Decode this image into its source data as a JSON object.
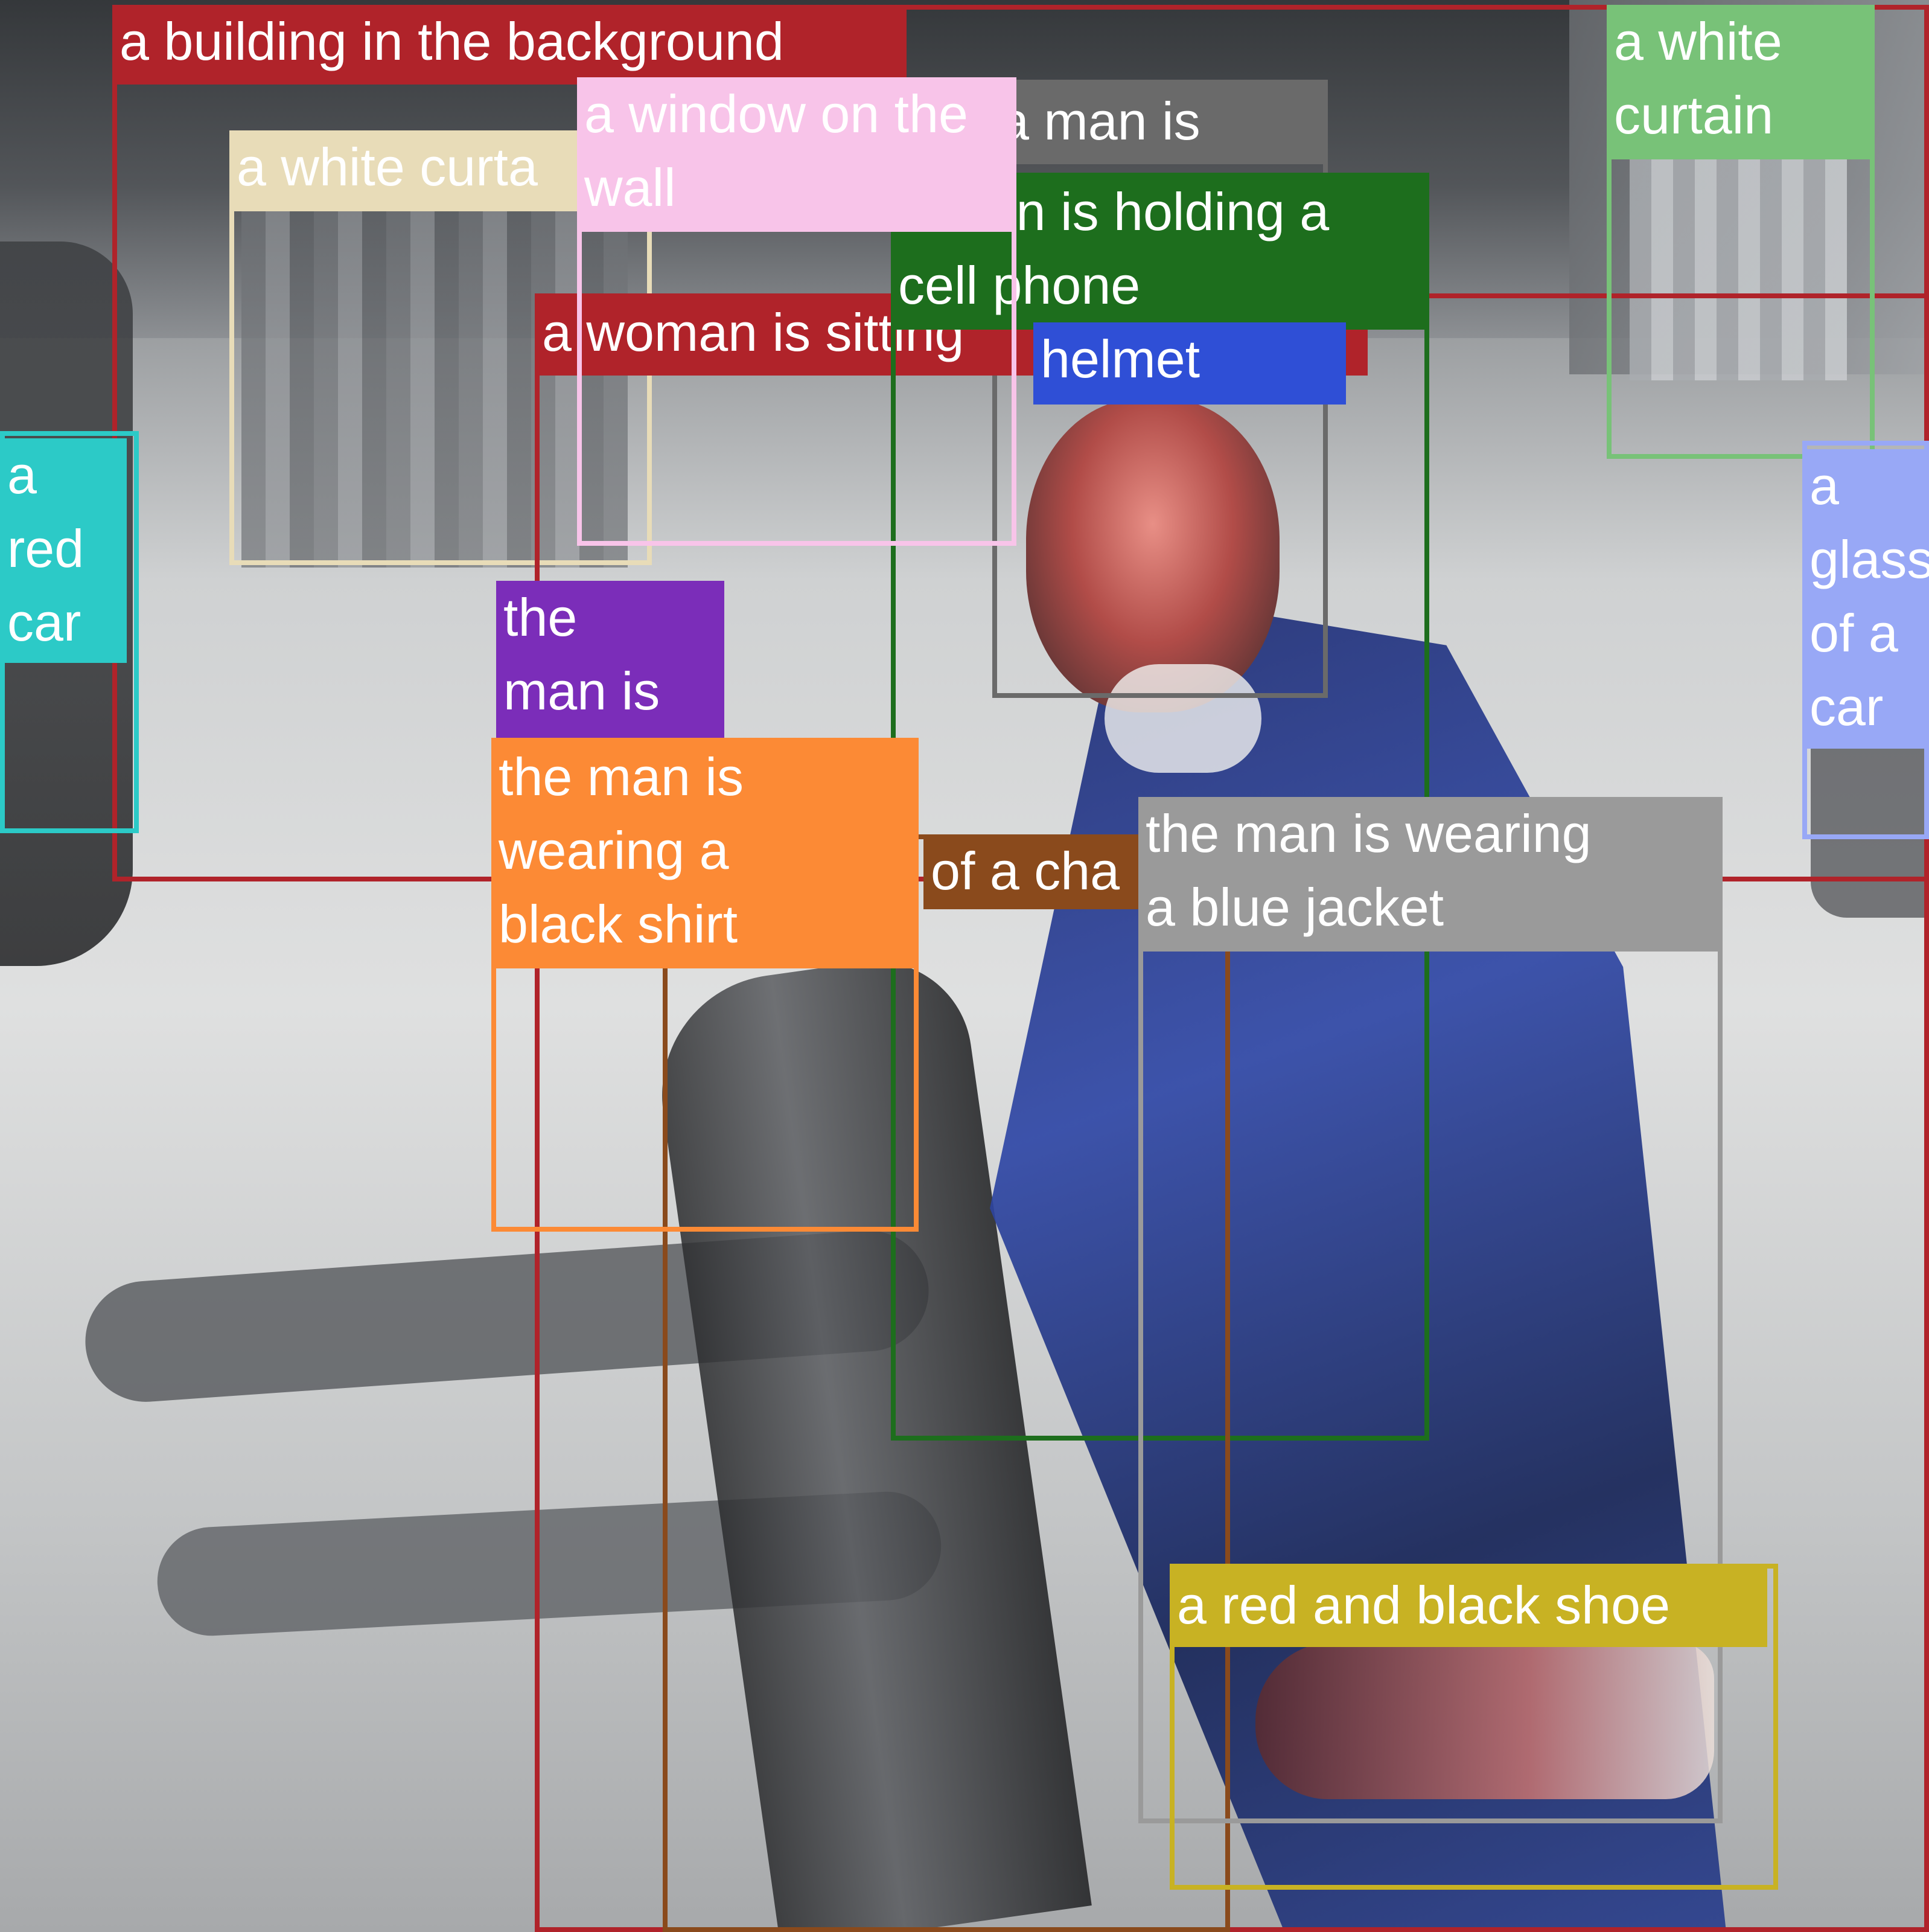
{
  "detections": [
    {
      "label": "a building in the background",
      "color": "#b0232a"
    },
    {
      "label": "a white curtain",
      "color": "#e8dcb8",
      "visible_text": "a white curta"
    },
    {
      "label": "a window on the wall",
      "color": "#f8c4e9"
    },
    {
      "label": "a man is",
      "color": "#6a6a6a",
      "visible_text": "a man is"
    },
    {
      "label": "a man is holding a cell phone",
      "color": "#1d6e1d",
      "visible_text": "a man is holding a\ncell phone"
    },
    {
      "label": "a woman is sitting",
      "color": "#b0232a",
      "visible_text": "a woman is sitting"
    },
    {
      "label": "helmet",
      "color": "#2f4fd6"
    },
    {
      "label": "a white curtain",
      "color": "#78c278",
      "visible_text": "a white\ncurtain"
    },
    {
      "label": "a red car",
      "color": "#2ccac7",
      "visible_text": "a\nred\ncar"
    },
    {
      "label": "a glass of a car",
      "color": "#98a8f6",
      "visible_text": "a\nglass\nof a\ncar"
    },
    {
      "label": "the man is",
      "color": "#7b2db9",
      "visible_text": "the\nman is"
    },
    {
      "label": "the man is wearing a black shirt",
      "color": "#fc8a35",
      "visible_text": "the man is\nwearing a\nblack shirt"
    },
    {
      "label": "of a cha",
      "color": "#8a4a1c",
      "visible_text": "of a cha"
    },
    {
      "label": "the man is wearing a blue jacket",
      "color": "#9a9a9a",
      "visible_text": "the man is wearing\na blue jacket"
    },
    {
      "label": "a red and black shoe",
      "color": "#c8b223"
    }
  ]
}
